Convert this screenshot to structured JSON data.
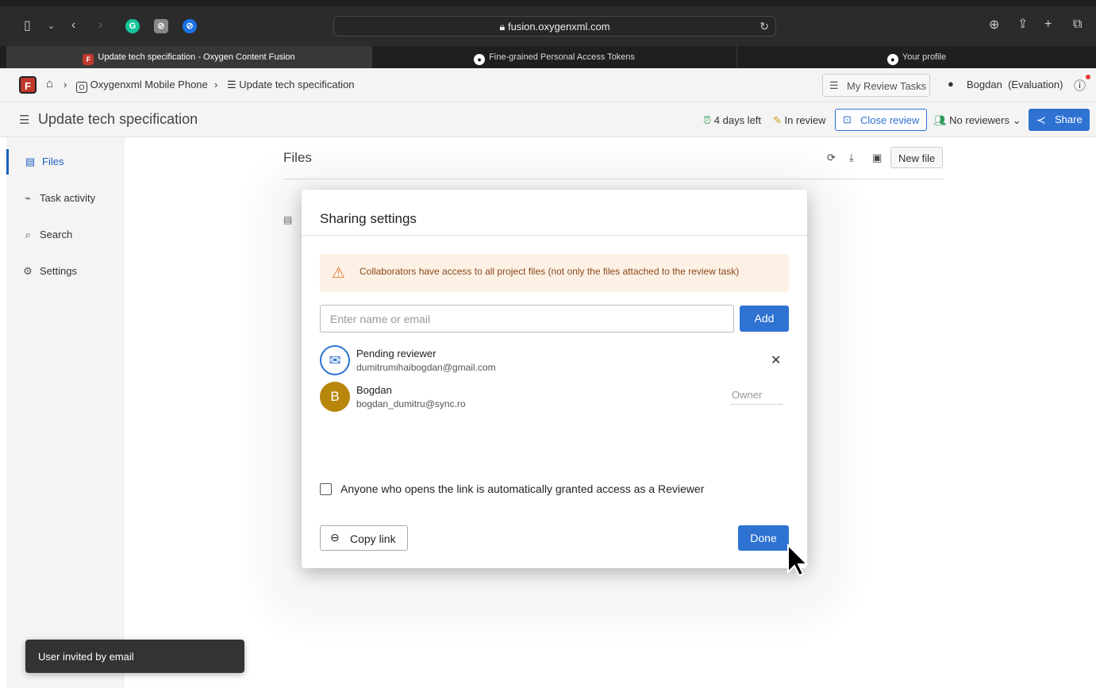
{
  "browser": {
    "url": "fusion.oxygenxml.com",
    "tabs": [
      {
        "label": "Update tech specification - Oxygen Content Fusion",
        "active": true
      },
      {
        "label": "Fine-grained Personal Access Tokens",
        "active": false
      },
      {
        "label": "Your profile",
        "active": false
      }
    ]
  },
  "header": {
    "breadcrumb": {
      "project": "Oxygenxml Mobile Phone",
      "task": "Update tech specification"
    },
    "my_review_tasks": "My Review Tasks",
    "user": "Bogdan",
    "user_suffix": "(Evaluation)"
  },
  "titlebar": {
    "title": "Update tech specification",
    "days_left": "4 days left",
    "status": "In review",
    "close_review": "Close review",
    "reviewers": "No reviewers",
    "share": "Share"
  },
  "sidebar": {
    "items": [
      {
        "label": "Files",
        "icon": "file-icon",
        "active": true
      },
      {
        "label": "Task activity",
        "icon": "activity-icon",
        "active": false
      },
      {
        "label": "Search",
        "icon": "search-icon",
        "active": false
      },
      {
        "label": "Settings",
        "icon": "gear-icon",
        "active": false
      }
    ]
  },
  "main": {
    "title": "Files",
    "new_file": "New file"
  },
  "dialog": {
    "title": "Sharing settings",
    "warning": "Collaborators have access to all project files (not only the files attached to the review task)",
    "input_placeholder": "Enter name or email",
    "add": "Add",
    "people": [
      {
        "name": "Pending reviewer",
        "email": "dumitrumihaibogdan@gmail.com",
        "avatar": "envelope-icon"
      },
      {
        "name": "Bogdan",
        "email": "bogdan_dumitru@sync.ro",
        "initial": "B",
        "role": "Owner"
      }
    ],
    "checkbox_label": "Anyone who opens the link is automatically granted access as a Reviewer",
    "copy_link": "Copy link",
    "done": "Done"
  },
  "toast": "User invited by email",
  "colors": {
    "primary": "#2e72d2",
    "warning_bg": "#fdf1e6",
    "warning_icon": "#e0762d",
    "avatar_b": "#b8860b"
  }
}
